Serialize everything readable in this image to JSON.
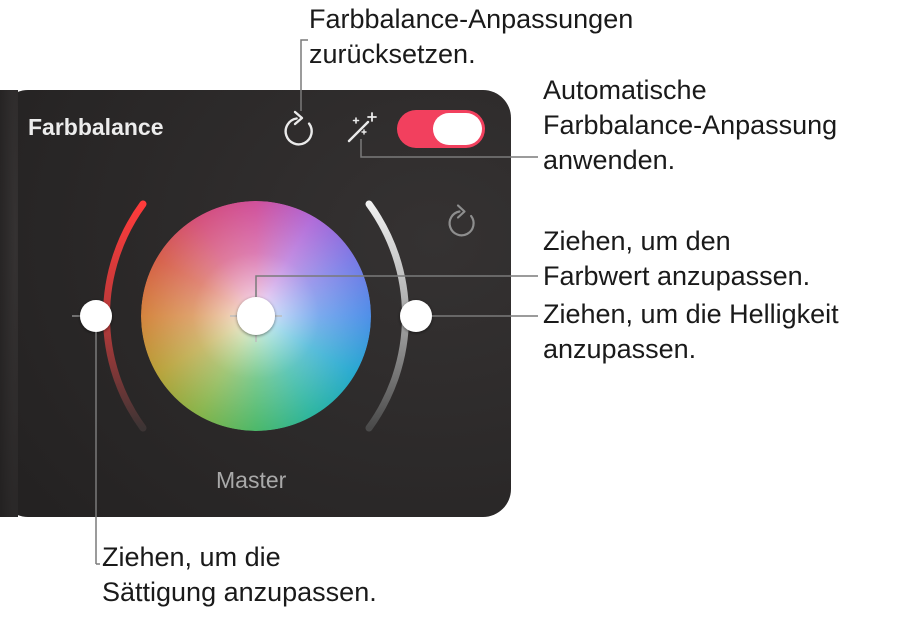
{
  "panel": {
    "title": "Farbbalance",
    "wheel_label": "Master",
    "reset_icon": "reset-arrow-icon",
    "auto_icon": "magic-wand-icon",
    "toggle_on": true
  },
  "colors": {
    "panel_bg": "#2b2929",
    "toggle_on": "#f2405e",
    "saturation_arc": "#e94242",
    "brightness_arc": "#d0d0d0"
  },
  "callouts": {
    "reset": [
      "Farbbalance-Anpassungen",
      "zurücksetzen."
    ],
    "auto": [
      "Automatische",
      "Farbbalance-Anpassung",
      "anwenden."
    ],
    "hue": [
      "Ziehen, um den",
      "Farbwert anzupassen."
    ],
    "brightness": [
      "Ziehen, um die Helligkeit",
      "anzupassen."
    ],
    "saturation": [
      "Ziehen, um die",
      "Sättigung anzupassen."
    ]
  }
}
